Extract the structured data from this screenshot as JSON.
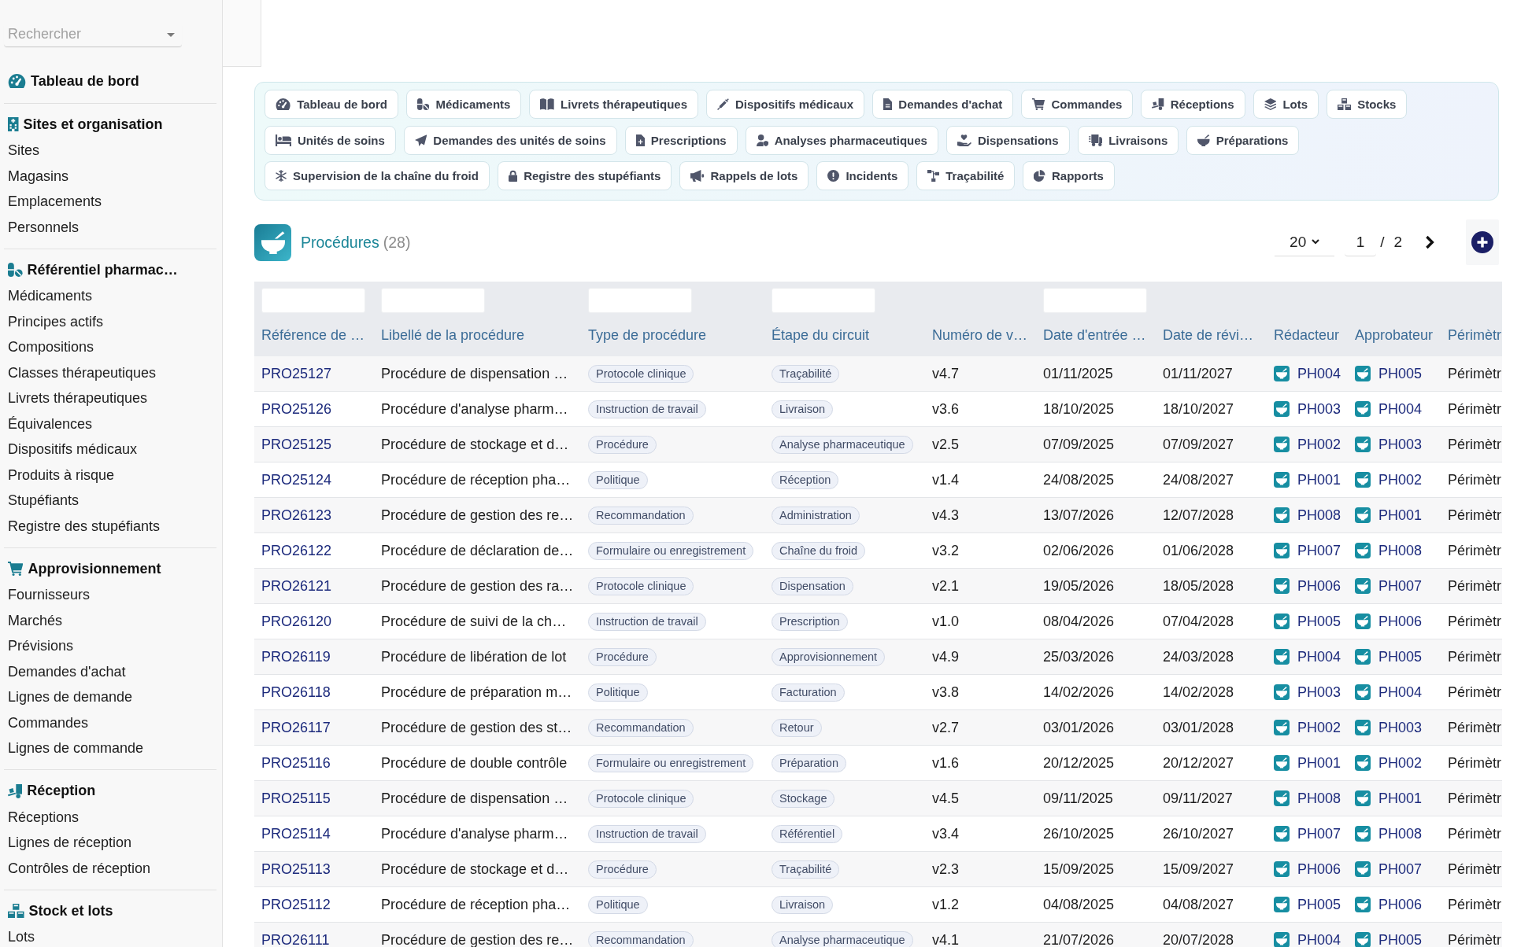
{
  "sidebar": {
    "search": {
      "placeholder": "Rechercher"
    },
    "sections": [
      {
        "title": "Tableau de bord"
      },
      {
        "title": "Sites et organisation",
        "items": [
          "Sites",
          "Magasins",
          "Emplacements",
          "Personnels"
        ]
      },
      {
        "title": "Référentiel pharmac…",
        "items": [
          "Médicaments",
          "Principes actifs",
          "Compositions",
          "Classes thérapeutiques",
          "Livrets thérapeutiques",
          "Équivalences",
          "Dispositifs médicaux",
          "Produits à risque",
          "Stupéfiants",
          "Registre des stupéfiants"
        ]
      },
      {
        "title": "Approvisionnement",
        "items": [
          "Fournisseurs",
          "Marchés",
          "Prévisions",
          "Demandes d'achat",
          "Lignes de demande",
          "Commandes",
          "Lignes de commande"
        ]
      },
      {
        "title": "Réception",
        "items": [
          "Réceptions",
          "Lignes de réception",
          "Contrôles de réception"
        ]
      },
      {
        "title": "Stock et lots",
        "items": [
          "Lots"
        ]
      }
    ]
  },
  "modules": [
    "Tableau de bord",
    "Médicaments",
    "Livrets thérapeutiques",
    "Dispositifs médicaux",
    "Demandes d'achat",
    "Commandes",
    "Réceptions",
    "Lots",
    "Stocks",
    "Unités de soins",
    "Demandes des unités de soins",
    "Prescriptions",
    "Analyses pharmaceutiques",
    "Dispensations",
    "Livraisons",
    "Préparations",
    "Supervision de la chaîne du froid",
    "Registre des stupéfiants",
    "Rappels de lots",
    "Incidents",
    "Traçabilité",
    "Rapports"
  ],
  "page": {
    "title": "Procédures",
    "count": "(28)",
    "pagination": {
      "page_size": "20",
      "current_page": "1",
      "separator": "/",
      "total_pages": "2"
    }
  },
  "table": {
    "columns": [
      {
        "label": "Référence de …",
        "filter": true
      },
      {
        "label": "Libellé de la procédure",
        "filter": true
      },
      {
        "label": "Type de procédure",
        "filter": true
      },
      {
        "label": "Étape du circuit",
        "filter": true
      },
      {
        "label": "Numéro de v…",
        "filter": false
      },
      {
        "label": "Date d'entrée …",
        "filter": true
      },
      {
        "label": "Date de révi…",
        "filter": false
      },
      {
        "label": "Rédacteur",
        "filter": false
      },
      {
        "label": "Approbateur",
        "filter": false
      },
      {
        "label": "Périmètr",
        "filter": false
      }
    ],
    "rows": [
      {
        "reference": "PRO25127",
        "title": "Procédure de dispensation …",
        "type": "Protocole clinique",
        "step": "Traçabilité",
        "version": "v4.7",
        "entry_date": "01/11/2025",
        "review_date": "01/11/2027",
        "author": "PH004",
        "approver": "PH005",
        "scope": "Périmètr"
      },
      {
        "reference": "PRO25126",
        "title": "Procédure d'analyse pharm…",
        "type": "Instruction de travail",
        "step": "Livraison",
        "version": "v3.6",
        "entry_date": "18/10/2025",
        "review_date": "18/10/2027",
        "author": "PH003",
        "approver": "PH004",
        "scope": "Périmètr"
      },
      {
        "reference": "PRO25125",
        "title": "Procédure de stockage et d…",
        "type": "Procédure",
        "step": "Analyse pharmaceutique",
        "version": "v2.5",
        "entry_date": "07/09/2025",
        "review_date": "07/09/2027",
        "author": "PH002",
        "approver": "PH003",
        "scope": "Périmètr"
      },
      {
        "reference": "PRO25124",
        "title": "Procédure de réception pha…",
        "type": "Politique",
        "step": "Réception",
        "version": "v1.4",
        "entry_date": "24/08/2025",
        "review_date": "24/08/2027",
        "author": "PH001",
        "approver": "PH002",
        "scope": "Périmètr"
      },
      {
        "reference": "PRO26123",
        "title": "Procédure de gestion des re…",
        "type": "Recommandation",
        "step": "Administration",
        "version": "v4.3",
        "entry_date": "13/07/2026",
        "review_date": "12/07/2028",
        "author": "PH008",
        "approver": "PH001",
        "scope": "Périmètr"
      },
      {
        "reference": "PRO26122",
        "title": "Procédure de déclaration de…",
        "type": "Formulaire ou enregistrement",
        "step": "Chaîne du froid",
        "version": "v3.2",
        "entry_date": "02/06/2026",
        "review_date": "01/06/2028",
        "author": "PH007",
        "approver": "PH008",
        "scope": "Périmètr"
      },
      {
        "reference": "PRO26121",
        "title": "Procédure de gestion des ra…",
        "type": "Protocole clinique",
        "step": "Dispensation",
        "version": "v2.1",
        "entry_date": "19/05/2026",
        "review_date": "18/05/2028",
        "author": "PH006",
        "approver": "PH007",
        "scope": "Périmètr"
      },
      {
        "reference": "PRO26120",
        "title": "Procédure de suivi de la ch…",
        "type": "Instruction de travail",
        "step": "Prescription",
        "version": "v1.0",
        "entry_date": "08/04/2026",
        "review_date": "07/04/2028",
        "author": "PH005",
        "approver": "PH006",
        "scope": "Périmètr"
      },
      {
        "reference": "PRO26119",
        "title": "Procédure de libération de lot",
        "type": "Procédure",
        "step": "Approvisionnement",
        "version": "v4.9",
        "entry_date": "25/03/2026",
        "review_date": "24/03/2028",
        "author": "PH004",
        "approver": "PH005",
        "scope": "Périmètr"
      },
      {
        "reference": "PRO26118",
        "title": "Procédure de préparation m…",
        "type": "Politique",
        "step": "Facturation",
        "version": "v3.8",
        "entry_date": "14/02/2026",
        "review_date": "14/02/2028",
        "author": "PH003",
        "approver": "PH004",
        "scope": "Périmètr"
      },
      {
        "reference": "PRO26117",
        "title": "Procédure de gestion des st…",
        "type": "Recommandation",
        "step": "Retour",
        "version": "v2.7",
        "entry_date": "03/01/2026",
        "review_date": "03/01/2028",
        "author": "PH002",
        "approver": "PH003",
        "scope": "Périmètr"
      },
      {
        "reference": "PRO25116",
        "title": "Procédure de double contrôle",
        "type": "Formulaire ou enregistrement",
        "step": "Préparation",
        "version": "v1.6",
        "entry_date": "20/12/2025",
        "review_date": "20/12/2027",
        "author": "PH001",
        "approver": "PH002",
        "scope": "Périmètr"
      },
      {
        "reference": "PRO25115",
        "title": "Procédure de dispensation …",
        "type": "Protocole clinique",
        "step": "Stockage",
        "version": "v4.5",
        "entry_date": "09/11/2025",
        "review_date": "09/11/2027",
        "author": "PH008",
        "approver": "PH001",
        "scope": "Périmètr"
      },
      {
        "reference": "PRO25114",
        "title": "Procédure d'analyse pharm…",
        "type": "Instruction de travail",
        "step": "Référentiel",
        "version": "v3.4",
        "entry_date": "26/10/2025",
        "review_date": "26/10/2027",
        "author": "PH007",
        "approver": "PH008",
        "scope": "Périmètr"
      },
      {
        "reference": "PRO25113",
        "title": "Procédure de stockage et d…",
        "type": "Procédure",
        "step": "Traçabilité",
        "version": "v2.3",
        "entry_date": "15/09/2025",
        "review_date": "15/09/2027",
        "author": "PH006",
        "approver": "PH007",
        "scope": "Périmètr"
      },
      {
        "reference": "PRO25112",
        "title": "Procédure de réception pha…",
        "type": "Politique",
        "step": "Livraison",
        "version": "v1.2",
        "entry_date": "04/08/2025",
        "review_date": "04/08/2027",
        "author": "PH005",
        "approver": "PH006",
        "scope": "Périmètr"
      },
      {
        "reference": "PRO26111",
        "title": "Procédure de gestion des re…",
        "type": "Recommandation",
        "step": "Analyse pharmaceutique",
        "version": "v4.1",
        "entry_date": "21/07/2026",
        "review_date": "20/07/2028",
        "author": "PH004",
        "approver": "PH005",
        "scope": "Périmètr"
      }
    ]
  }
}
